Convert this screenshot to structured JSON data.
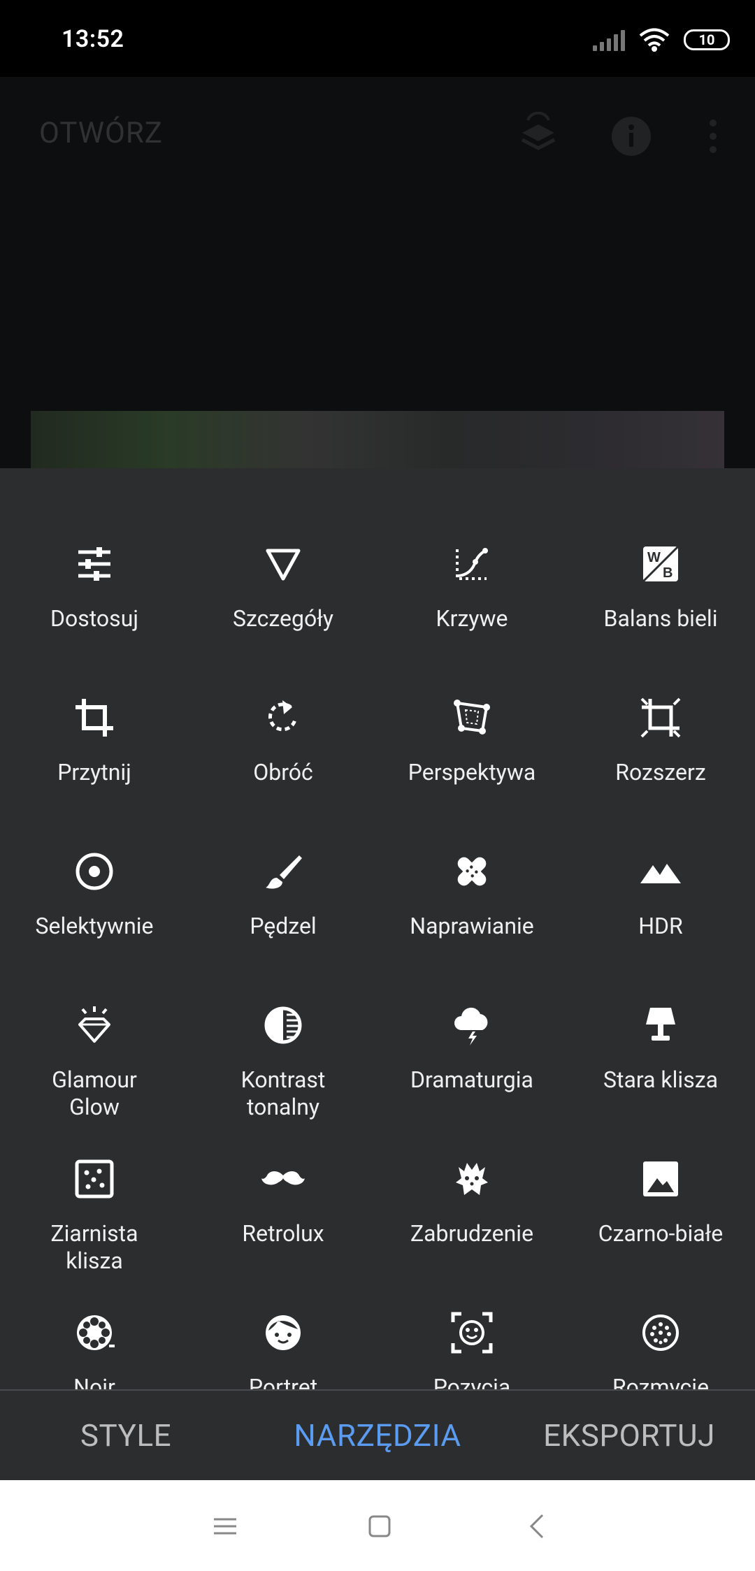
{
  "status": {
    "time": "13:52",
    "battery": "10"
  },
  "header": {
    "open_label": "OTWÓRZ"
  },
  "tools": [
    {
      "label": "Dostosuj",
      "icon": "sliders-icon"
    },
    {
      "label": "Szczegóły",
      "icon": "triangle-down-icon"
    },
    {
      "label": "Krzywe",
      "icon": "curves-icon"
    },
    {
      "label": "Balans bieli",
      "icon": "white-balance-icon"
    },
    {
      "label": "Przytnij",
      "icon": "crop-icon"
    },
    {
      "label": "Obróć",
      "icon": "rotate-icon"
    },
    {
      "label": "Perspektywa",
      "icon": "perspective-icon"
    },
    {
      "label": "Rozszerz",
      "icon": "expand-icon"
    },
    {
      "label": "Selektywnie",
      "icon": "target-icon"
    },
    {
      "label": "Pędzel",
      "icon": "brush-icon"
    },
    {
      "label": "Naprawianie",
      "icon": "bandage-icon"
    },
    {
      "label": "HDR",
      "icon": "mountains-icon"
    },
    {
      "label": "Glamour\nGlow",
      "icon": "diamond-icon"
    },
    {
      "label": "Kontrast\ntonalny",
      "icon": "tonal-contrast-icon"
    },
    {
      "label": "Dramaturgia",
      "icon": "cloud-icon"
    },
    {
      "label": "Stara klisza",
      "icon": "lamp-icon"
    },
    {
      "label": "Ziarnista\nklisza",
      "icon": "grain-icon"
    },
    {
      "label": "Retrolux",
      "icon": "mustache-icon"
    },
    {
      "label": "Zabrudzenie",
      "icon": "grunge-icon"
    },
    {
      "label": "Czarno-białe",
      "icon": "bw-icon"
    },
    {
      "label": "Noir",
      "icon": "film-reel-icon"
    },
    {
      "label": "Portret",
      "icon": "face-icon"
    },
    {
      "label": "Pozycja",
      "icon": "face-frame-icon"
    },
    {
      "label": "Rozmycie",
      "icon": "blur-icon"
    }
  ],
  "tabs": [
    {
      "label": "STYLE",
      "active": false
    },
    {
      "label": "NARZĘDZIA",
      "active": true
    },
    {
      "label": "EKSPORTUJ",
      "active": false
    }
  ],
  "colors": {
    "panel": "#2c2d2f",
    "accent": "#5b9cf0",
    "tab_text": "#bdbdbd"
  }
}
